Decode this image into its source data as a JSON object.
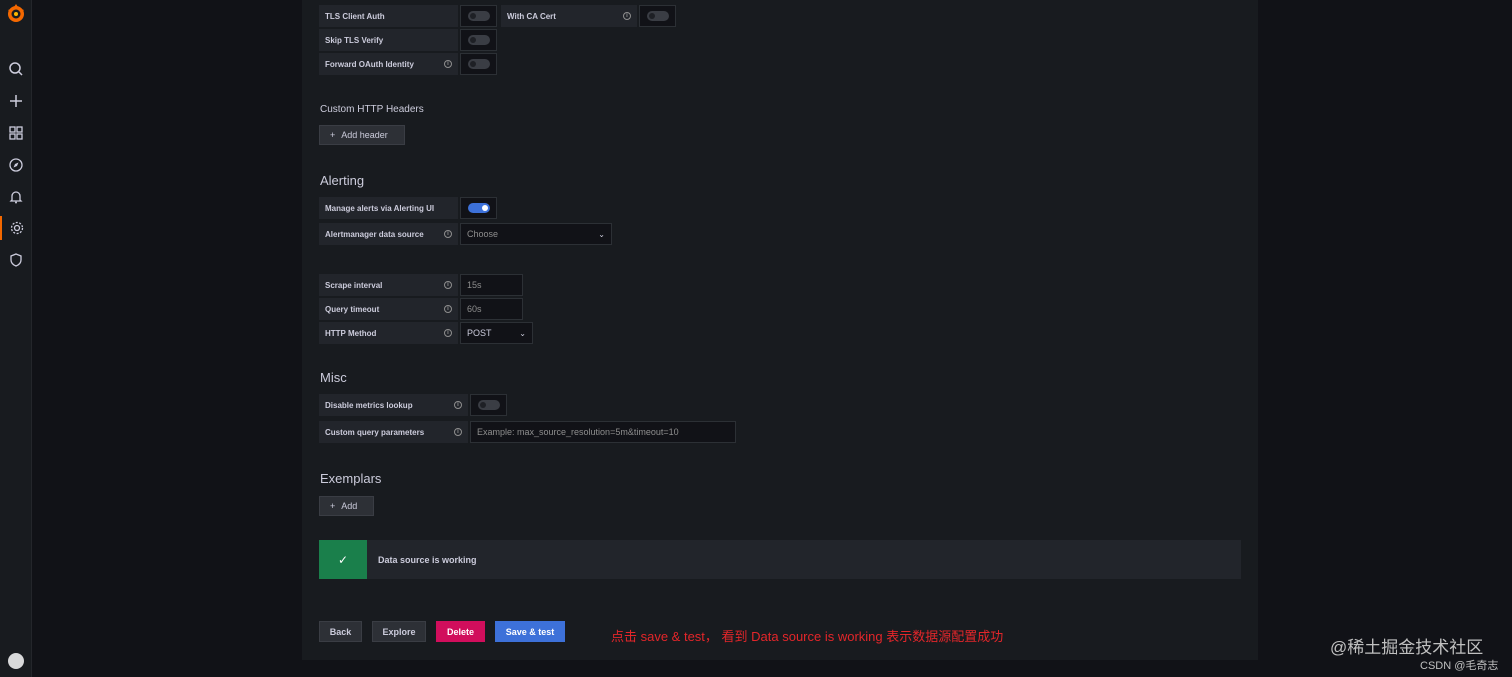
{
  "sidebar": {
    "items": [
      "search-icon",
      "plus-icon",
      "dashboards-icon",
      "explore-icon",
      "alerting-icon",
      "configuration-icon",
      "shield-icon"
    ],
    "active": "configuration-icon",
    "accent": "#f46800"
  },
  "auth": {
    "tls_client_auth": "TLS Client Auth",
    "with_ca_cert": "With CA Cert",
    "skip_tls_verify": "Skip TLS Verify",
    "forward_oauth": "Forward OAuth Identity"
  },
  "headers": {
    "title": "Custom HTTP Headers",
    "add_label": "Add header"
  },
  "alerting": {
    "title": "Alerting",
    "manage_label": "Manage alerts via Alerting UI",
    "manage_on": true,
    "am_label": "Alertmanager data source",
    "am_placeholder": "Choose"
  },
  "prom": {
    "scrape_label": "Scrape interval",
    "scrape_placeholder": "15s",
    "timeout_label": "Query timeout",
    "timeout_placeholder": "60s",
    "method_label": "HTTP Method",
    "method_value": "POST"
  },
  "misc": {
    "title": "Misc",
    "disable_lookup_label": "Disable metrics lookup",
    "custom_params_label": "Custom query parameters",
    "custom_params_placeholder": "Example: max_source_resolution=5m&timeout=10"
  },
  "exemplars": {
    "title": "Exemplars",
    "add_label": "Add"
  },
  "status": {
    "message": "Data source is working",
    "color": "#1a7f4b"
  },
  "footer": {
    "back": "Back",
    "explore": "Explore",
    "delete": "Delete",
    "save_test": "Save & test",
    "delete_color": "#d10e5c",
    "save_color": "#3d71d9"
  },
  "annotation": "点击 save & test， 看到 Data source is working 表示数据源配置成功",
  "watermark": {
    "line1": "@稀土掘金技术社区",
    "line2": "CSDN @毛奇志"
  }
}
